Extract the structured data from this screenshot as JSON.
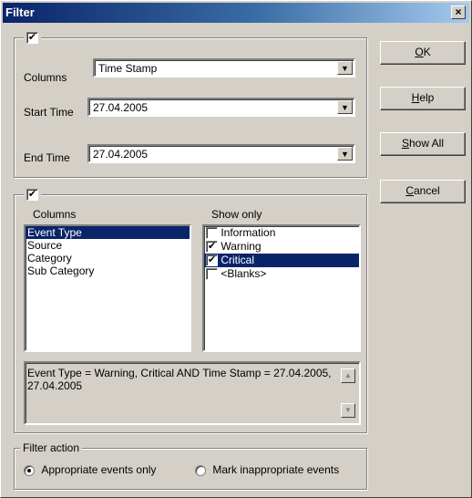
{
  "window": {
    "title": "Filter",
    "close_glyph": "×"
  },
  "time_group": {
    "checked": true,
    "columns_label": "Columns",
    "columns_value": "Time Stamp",
    "start_label": "Start Time",
    "start_value": "27.04.2005",
    "end_label": "End Time",
    "end_value": "27.04.2005"
  },
  "column_group": {
    "checked": true,
    "columns_header": "Columns",
    "show_only_header": "Show only",
    "columns": [
      "Event Type",
      "Source",
      "Category",
      "Sub Category"
    ],
    "show_only": [
      {
        "label": "Information",
        "checked": false
      },
      {
        "label": "Warning",
        "checked": true
      },
      {
        "label": "Critical",
        "checked": true
      },
      {
        "label": "<Blanks>",
        "checked": false
      }
    ],
    "expression": "Event Type = Warning, Critical AND Time Stamp = 27.04.2005, 27.04.2005"
  },
  "filter_action": {
    "legend": "Filter action",
    "option1": "Appropriate events only",
    "option2": "Mark inappropriate events",
    "selected": 1
  },
  "buttons": {
    "ok_mnemonic": "O",
    "ok_rest": "K",
    "help_mnemonic": "H",
    "help_rest": "elp",
    "showall_mnemonic": "S",
    "showall_rest": "how All",
    "cancel_mnemonic": "C",
    "cancel_rest": "ancel"
  },
  "icons": {
    "dropdown": "▼",
    "check": "✔",
    "scroll_up": "▲",
    "scroll_down": "▼"
  }
}
